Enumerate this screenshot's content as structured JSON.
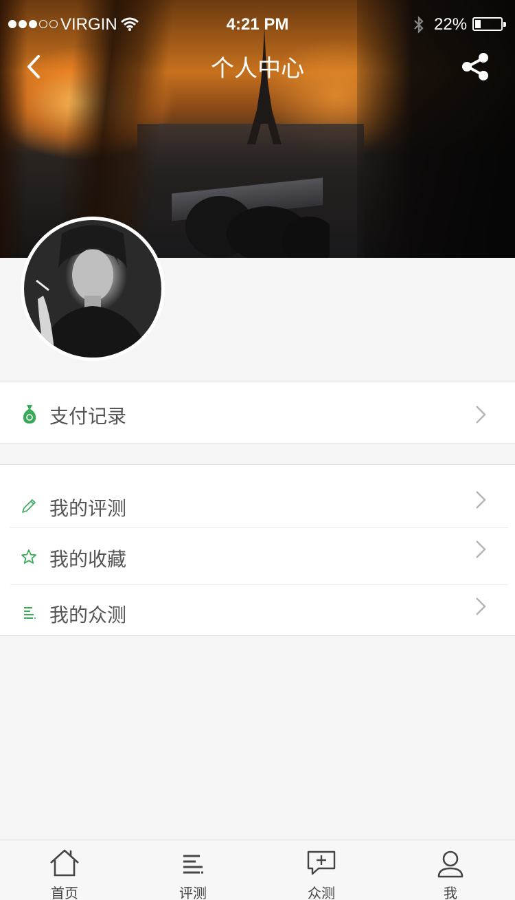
{
  "status_bar": {
    "carrier": "VIRGIN",
    "time": "4:21 PM",
    "battery": "22%",
    "battery_level": 0.22,
    "signal_bars": 3,
    "signal_total": 5
  },
  "header": {
    "title": "个人中心",
    "back_icon": "chevron-left-icon",
    "share_icon": "share-icon"
  },
  "menu_group_1": [
    {
      "label": "支付记录",
      "icon": "money-bag-icon"
    }
  ],
  "menu_group_2": [
    {
      "label": "我的评测",
      "icon": "pencil-icon"
    },
    {
      "label": "我的收藏",
      "icon": "star-icon"
    },
    {
      "label": "我的众测",
      "icon": "list-icon"
    }
  ],
  "tabbar": [
    {
      "label": "首页",
      "icon": "home-icon"
    },
    {
      "label": "评测",
      "icon": "list-icon"
    },
    {
      "label": "众测",
      "icon": "comment-add-icon"
    },
    {
      "label": "我",
      "icon": "user-icon"
    }
  ],
  "colors": {
    "accent": "#3aaa5a",
    "background": "#f5f5f5",
    "text": "#555555"
  }
}
